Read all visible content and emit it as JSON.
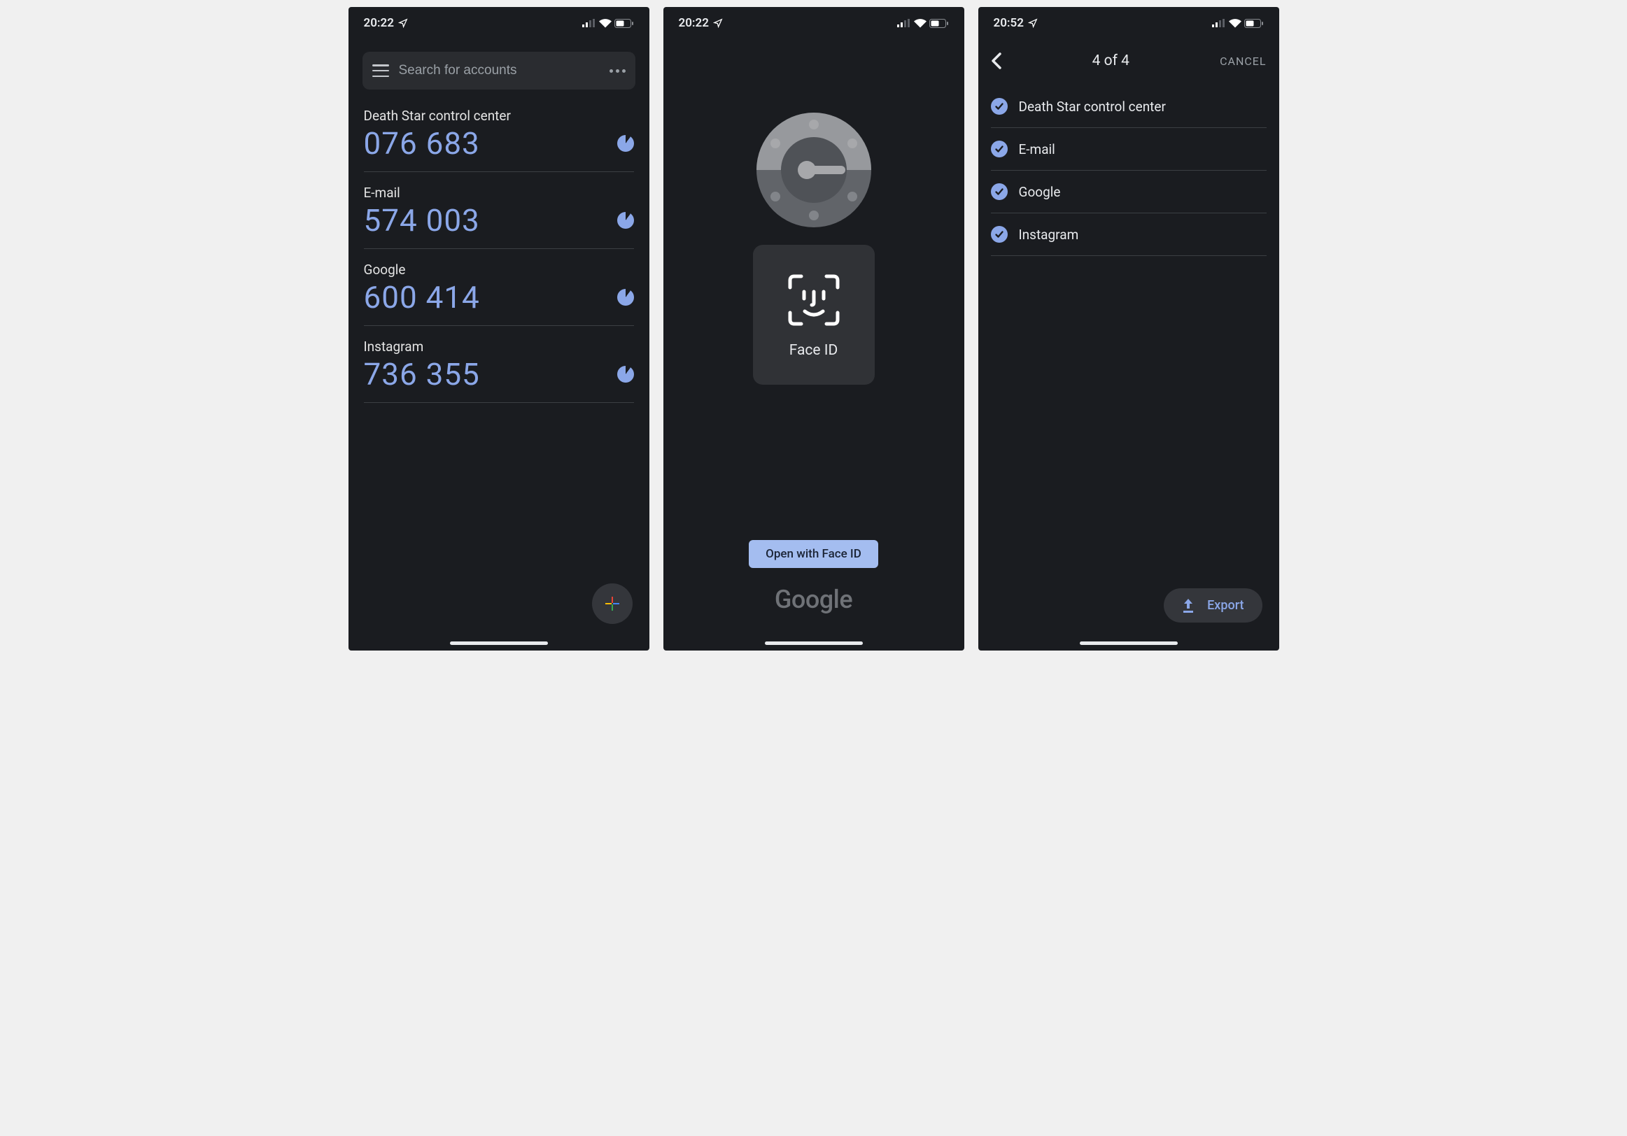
{
  "status": {
    "times": [
      "20:22",
      "20:22",
      "20:52"
    ]
  },
  "screen1": {
    "search_placeholder": "Search for accounts",
    "accounts": [
      {
        "name": "Death Star control center",
        "code": "076 683"
      },
      {
        "name": "E-mail",
        "code": "574 003"
      },
      {
        "name": "Google",
        "code": "600 414"
      },
      {
        "name": "Instagram",
        "code": "736 355"
      }
    ]
  },
  "screen2": {
    "faceid_label": "Face ID",
    "open_button": "Open with Face ID",
    "brand": "Google"
  },
  "screen3": {
    "title": "4 of 4",
    "cancel": "CANCEL",
    "items": [
      "Death Star control center",
      "E-mail",
      "Google",
      "Instagram"
    ],
    "export_label": "Export"
  }
}
